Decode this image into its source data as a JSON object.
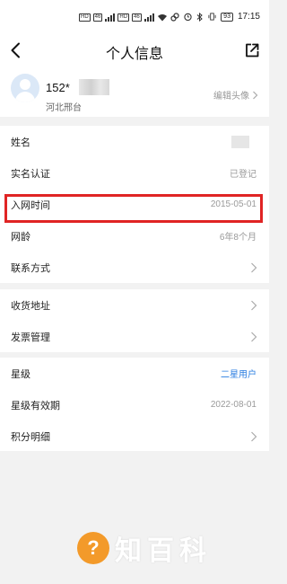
{
  "status_bar": {
    "left_tags": [
      "HD",
      "46",
      "HD",
      "46"
    ],
    "right_time": "17:15",
    "battery": "93"
  },
  "nav": {
    "title": "个人信息",
    "back_icon": "chevron-left-icon",
    "share_icon": "share-external-icon"
  },
  "profile": {
    "phone_prefix": "152*",
    "location": "河北邢台",
    "edit_avatar_label": "编辑头像"
  },
  "section_1": {
    "rows": [
      {
        "label": "姓名",
        "value": ""
      },
      {
        "label": "实名认证",
        "value": "已登记"
      },
      {
        "label": "入网时间",
        "value": "2015-05-01"
      },
      {
        "label": "网龄",
        "value": "6年8个月"
      },
      {
        "label": "联系方式",
        "value": ""
      }
    ]
  },
  "section_2": {
    "rows": [
      {
        "label": "收货地址"
      },
      {
        "label": "发票管理"
      }
    ]
  },
  "section_3": {
    "rows": [
      {
        "label": "星级",
        "value": "二星用户"
      },
      {
        "label": "星级有效期",
        "value": "2022-08-01"
      },
      {
        "label": "积分明细",
        "value": ""
      }
    ]
  },
  "watermark": {
    "text": "知百科"
  },
  "colors": {
    "accent_blue": "#2a7de1",
    "highlight_red": "#e02424",
    "watermark_orange": "#f39a2a"
  }
}
